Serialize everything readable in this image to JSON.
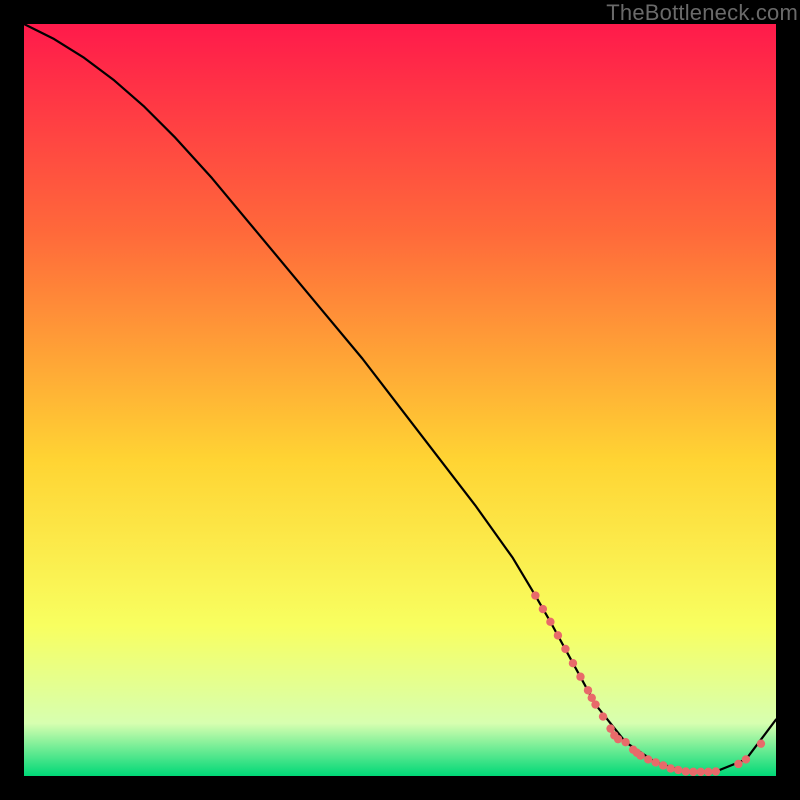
{
  "watermark": "TheBottleneck.com",
  "chart_data": {
    "type": "line",
    "title": "",
    "xlabel": "",
    "ylabel": "",
    "xlim": [
      0,
      100
    ],
    "ylim": [
      0,
      100
    ],
    "grid": false,
    "legend": false,
    "background_gradient": {
      "top": "#ff1a4b",
      "mid_upper": "#ff6a3a",
      "mid": "#ffd433",
      "mid_lower": "#f8ff60",
      "near_bottom": "#d7ffb0",
      "bottom": "#00d877"
    },
    "series": [
      {
        "name": "bottleneck-curve",
        "color": "#000000",
        "x": [
          0,
          4,
          8,
          12,
          16,
          20,
          25,
          30,
          35,
          40,
          45,
          50,
          55,
          60,
          65,
          68,
          70,
          73,
          76,
          80,
          84,
          88,
          92,
          96,
          100
        ],
        "y": [
          100,
          98,
          95.5,
          92.5,
          89,
          85,
          79.5,
          73.5,
          67.5,
          61.5,
          55.5,
          49,
          42.5,
          36,
          29,
          24,
          20.5,
          15,
          9.5,
          4.5,
          1.8,
          0.6,
          0.6,
          2.2,
          7.5
        ]
      }
    ],
    "markers": {
      "name": "highlight-points",
      "color": "#e86a6a",
      "radius": 4.2,
      "x": [
        68,
        69,
        70,
        71,
        72,
        73,
        74,
        75,
        75.5,
        76,
        77,
        78,
        78.5,
        79,
        80,
        81,
        81.5,
        82,
        83,
        84,
        85,
        86,
        87,
        88,
        89,
        90,
        91,
        92,
        95,
        96,
        98
      ],
      "y": [
        24,
        22.2,
        20.5,
        18.7,
        16.9,
        15,
        13.2,
        11.4,
        10.4,
        9.5,
        7.9,
        6.3,
        5.4,
        4.9,
        4.5,
        3.5,
        3.1,
        2.7,
        2.2,
        1.8,
        1.4,
        1.0,
        0.8,
        0.6,
        0.55,
        0.55,
        0.55,
        0.6,
        1.6,
        2.2,
        4.3
      ]
    }
  }
}
